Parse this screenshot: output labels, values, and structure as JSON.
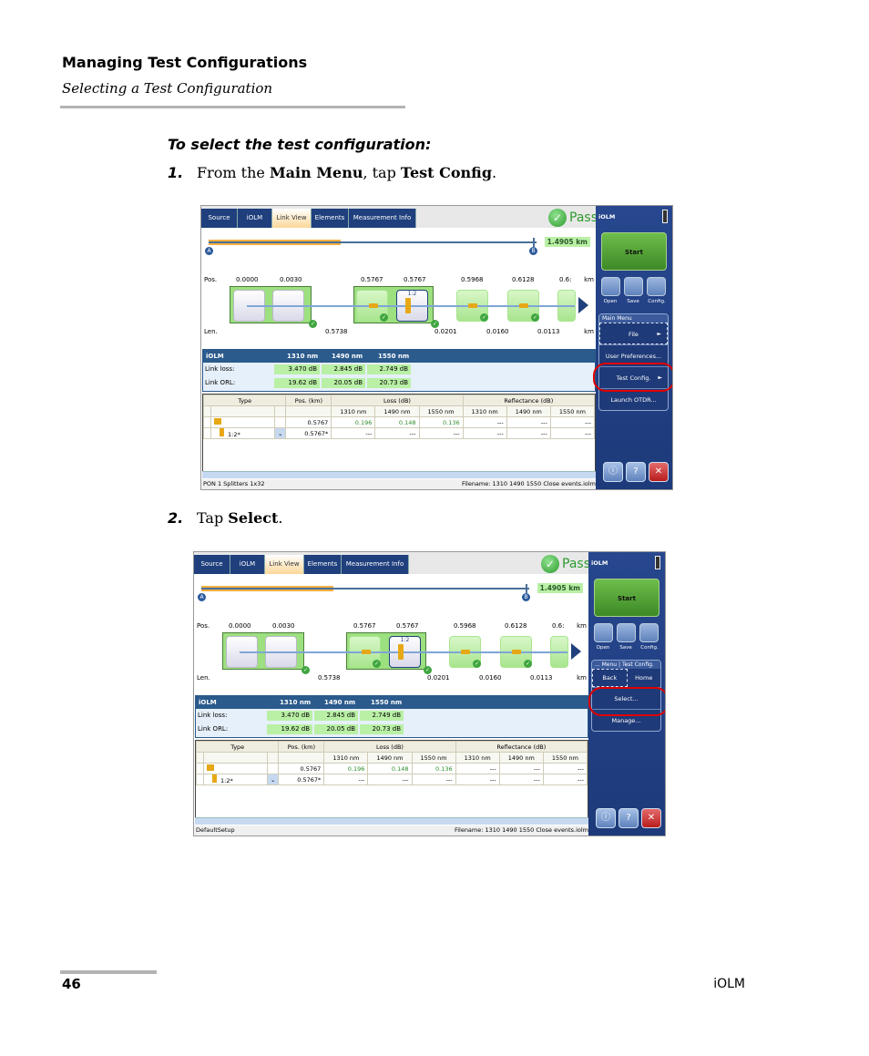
{
  "header": {
    "title": "Managing Test Configurations",
    "subtitle": "Selecting a Test Configuration"
  },
  "procedure": {
    "title": "To select the test configuration:",
    "steps": [
      {
        "num": "1.",
        "text_a": "From the ",
        "bold_a": "Main Menu",
        "text_b": ", tap ",
        "bold_b": "Test Config",
        "text_c": "."
      },
      {
        "num": "2.",
        "text_a": "Tap ",
        "bold_a": "Select",
        "text_b": "."
      }
    ]
  },
  "footer": {
    "page": "46",
    "product": "iOLM"
  },
  "app": {
    "tabs": [
      "Source",
      "iOLM",
      "Link View",
      "Elements",
      "Measurement Info"
    ],
    "active_tab": "Link View",
    "verdict": "Pass",
    "link_length": "1.4905 km",
    "point_a": "A",
    "point_b": "B",
    "pos_label": "Pos.",
    "len_label": "Len.",
    "unit": "km",
    "positions": [
      "0.0000",
      "0.0030",
      "0.5767",
      "0.5767",
      "0.5968",
      "0.6128",
      "0.6:"
    ],
    "lengths": [
      "0.5738",
      "0.0201",
      "0.0160",
      "0.0113"
    ],
    "splitter_ratio": "1:2",
    "summary": {
      "header": [
        "iOLM",
        "1310 nm",
        "1490 nm",
        "1550 nm"
      ],
      "rows": [
        {
          "label": "Link loss:",
          "values": [
            "3.470 dB",
            "2.845 dB",
            "2.749 dB"
          ]
        },
        {
          "label": "Link ORL:",
          "values": [
            "19.62 dB",
            "20.05 dB",
            "20.73 dB"
          ]
        }
      ]
    },
    "element_table": {
      "groups": [
        "Type",
        "Pos. (km)",
        "Loss (dB)",
        "Reflectance (dB)"
      ],
      "wavelengths": [
        "1310 nm",
        "1490 nm",
        "1550 nm",
        "1310 nm",
        "1490 nm",
        "1550 nm"
      ],
      "rows": [
        {
          "type": "",
          "pos": "0.5767",
          "loss": [
            "0.196",
            "0.148",
            "0.136"
          ],
          "refl": [
            "---",
            "---",
            "---"
          ]
        },
        {
          "type": "1:2*",
          "pos": "0.5767*",
          "loss": [
            "---",
            "---",
            "---"
          ],
          "refl": [
            "---",
            "---",
            "---"
          ]
        }
      ]
    },
    "filename": "Filename: 1310 1490 1550 Close events.iolm",
    "side": {
      "title": "iOLM",
      "start": "Start",
      "tools": [
        "Open",
        "Save",
        "Config."
      ]
    }
  },
  "screen1": {
    "status_left": "PON 1 Splitters 1x32",
    "menu_caption": "Main Menu",
    "menu_items": [
      {
        "label": "File",
        "arrow": "►"
      },
      {
        "label": "User Preferences...",
        "arrow": ""
      },
      {
        "label": "Test Config.",
        "arrow": "►"
      },
      {
        "label": "Launch OTDR...",
        "arrow": ""
      }
    ]
  },
  "screen2": {
    "status_left": "DefaultSetup",
    "menu_caption": "... Menu | Test Config.",
    "nav": [
      "Back",
      "Home"
    ],
    "menu_items": [
      {
        "label": "Select..."
      },
      {
        "label": "Manage..."
      }
    ]
  },
  "colors": {
    "highlight_circle": "#e00000",
    "pass_green": "#2e9b2e",
    "sidebar_blue": "#1f3a78"
  }
}
